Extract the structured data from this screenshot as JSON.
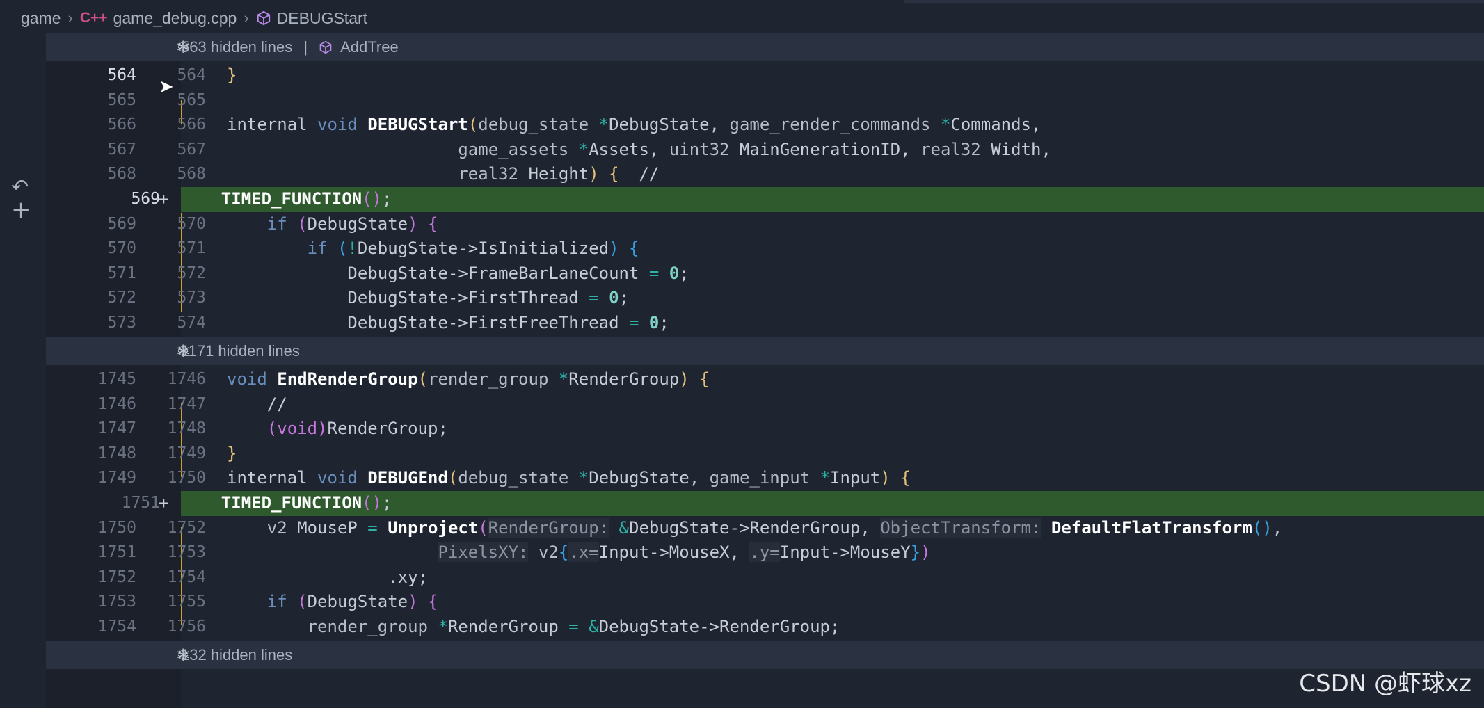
{
  "breadcrumb": {
    "folder": "game",
    "lang_badge": "C++",
    "file": "game_debug.cpp",
    "symbol": "DEBUGStart"
  },
  "folds": [
    {
      "text": "563 hidden lines",
      "divider": "|",
      "symbol": "AddTree"
    },
    {
      "text": "1171 hidden lines"
    },
    {
      "text": "132 hidden lines"
    }
  ],
  "rows": [
    {
      "a": "564",
      "b": "564"
    },
    {
      "a": "565",
      "b": "565"
    },
    {
      "a": "566",
      "b": "566"
    },
    {
      "a": "567",
      "b": "567"
    },
    {
      "a": "568",
      "b": "568"
    },
    {
      "a": "",
      "b": "569"
    },
    {
      "a": "569",
      "b": "570"
    },
    {
      "a": "570",
      "b": "571"
    },
    {
      "a": "571",
      "b": "572"
    },
    {
      "a": "572",
      "b": "573"
    },
    {
      "a": "573",
      "b": "574"
    },
    {
      "a": "1745",
      "b": "1746"
    },
    {
      "a": "1746",
      "b": "1747"
    },
    {
      "a": "1747",
      "b": "1748"
    },
    {
      "a": "1748",
      "b": "1749"
    },
    {
      "a": "1749",
      "b": "1750"
    },
    {
      "a": "",
      "b": "1751"
    },
    {
      "a": "1750",
      "b": "1752"
    },
    {
      "a": "1751",
      "b": "1753"
    },
    {
      "a": "1752",
      "b": "1754"
    },
    {
      "a": "1753",
      "b": "1755"
    },
    {
      "a": "1754",
      "b": "1756"
    }
  ],
  "plus_marker": "+",
  "watermark": "CSDN @虾球xz"
}
